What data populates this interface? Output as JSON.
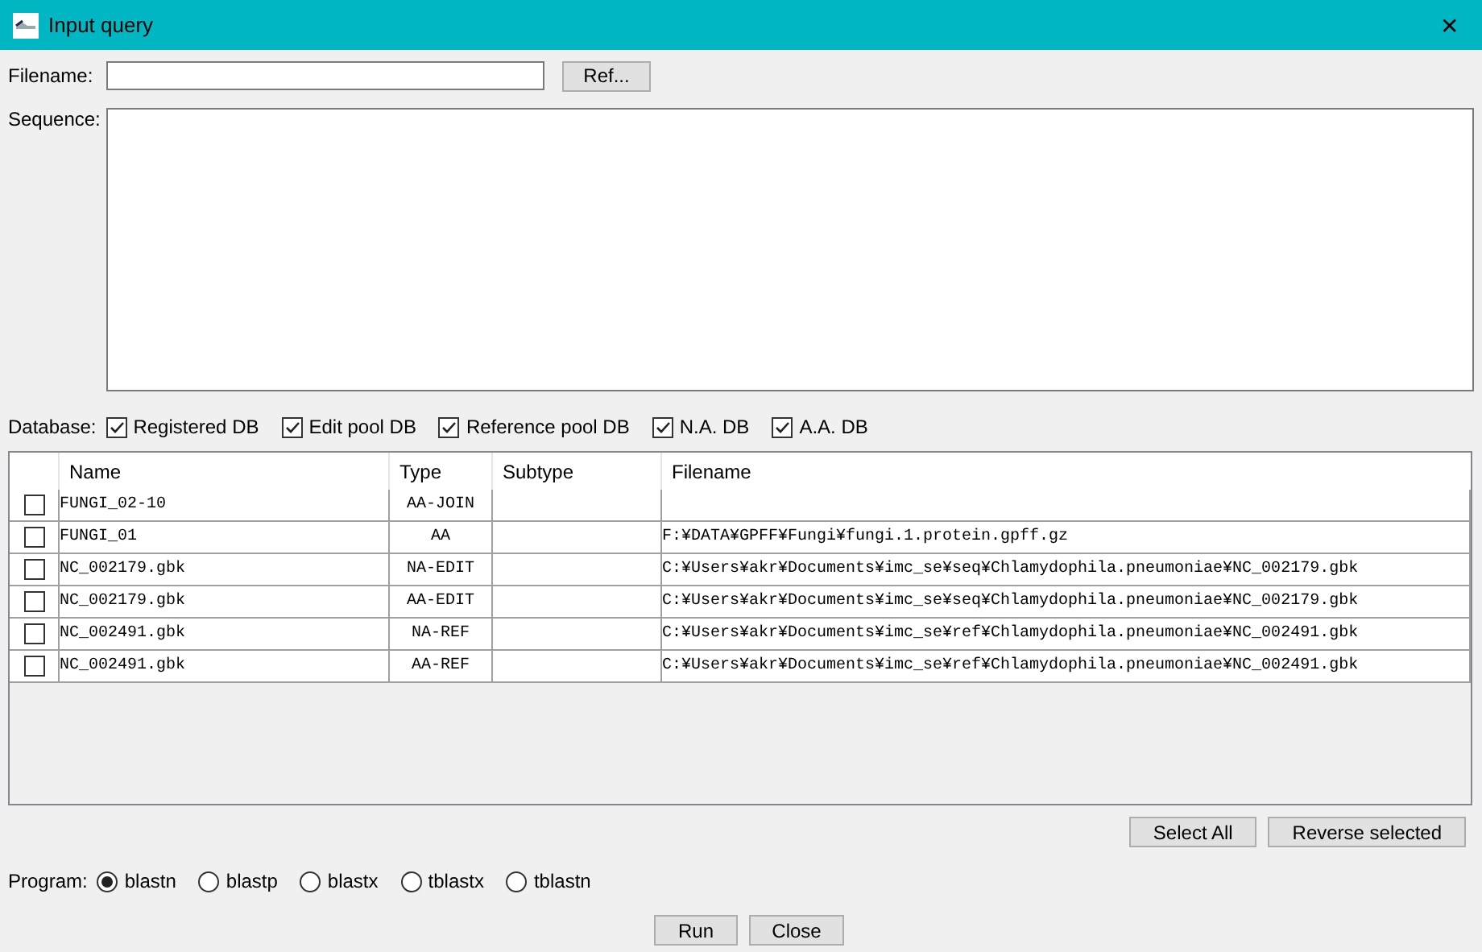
{
  "window": {
    "title": "Input query",
    "close": "✕"
  },
  "filename": {
    "label": "Filename:",
    "ref_button": "Ref..."
  },
  "sequence": {
    "label": "Sequence:"
  },
  "database": {
    "label": "Database:",
    "options": [
      {
        "label": "Registered DB",
        "checked": true
      },
      {
        "label": "Edit pool DB",
        "checked": true
      },
      {
        "label": "Reference pool DB",
        "checked": true
      },
      {
        "label": "N.A. DB",
        "checked": true
      },
      {
        "label": "A.A. DB",
        "checked": true
      }
    ]
  },
  "table": {
    "columns": [
      "Name",
      "Type",
      "Subtype",
      "Filename"
    ],
    "rows": [
      {
        "checked": false,
        "name": "FUNGI_02-10",
        "type": "AA-JOIN"
      },
      {
        "checked": false,
        "name": "FUNGI_01",
        "type": "AA",
        "filename": "F:¥DATA¥GPFF¥Fungi¥fungi.1.protein.gpff.gz"
      },
      {
        "checked": false,
        "name": "NC_002179.gbk",
        "type": "NA-EDIT",
        "filename": "C:¥Users¥akr¥Documents¥imc_se¥seq¥Chlamydophila.pneumoniae¥NC_002179.gbk"
      },
      {
        "checked": false,
        "name": "NC_002179.gbk",
        "type": "AA-EDIT",
        "filename": "C:¥Users¥akr¥Documents¥imc_se¥seq¥Chlamydophila.pneumoniae¥NC_002179.gbk"
      },
      {
        "checked": false,
        "name": "NC_002491.gbk",
        "type": "NA-REF",
        "filename": "C:¥Users¥akr¥Documents¥imc_se¥ref¥Chlamydophila.pneumoniae¥NC_002491.gbk"
      },
      {
        "checked": false,
        "name": "NC_002491.gbk",
        "type": "AA-REF",
        "filename": "C:¥Users¥akr¥Documents¥imc_se¥ref¥Chlamydophila.pneumoniae¥NC_002491.gbk"
      }
    ]
  },
  "table_buttons": [
    "Select All",
    "Reverse selected"
  ],
  "program": {
    "label": "Program:",
    "options": [
      {
        "label": "blastn",
        "selected": true
      },
      {
        "label": "blastp",
        "selected": false
      },
      {
        "label": "blastx",
        "selected": false
      },
      {
        "label": "tblastx",
        "selected": false
      },
      {
        "label": "tblastn",
        "selected": false
      }
    ]
  },
  "buttons": [
    "Run",
    "Close"
  ]
}
